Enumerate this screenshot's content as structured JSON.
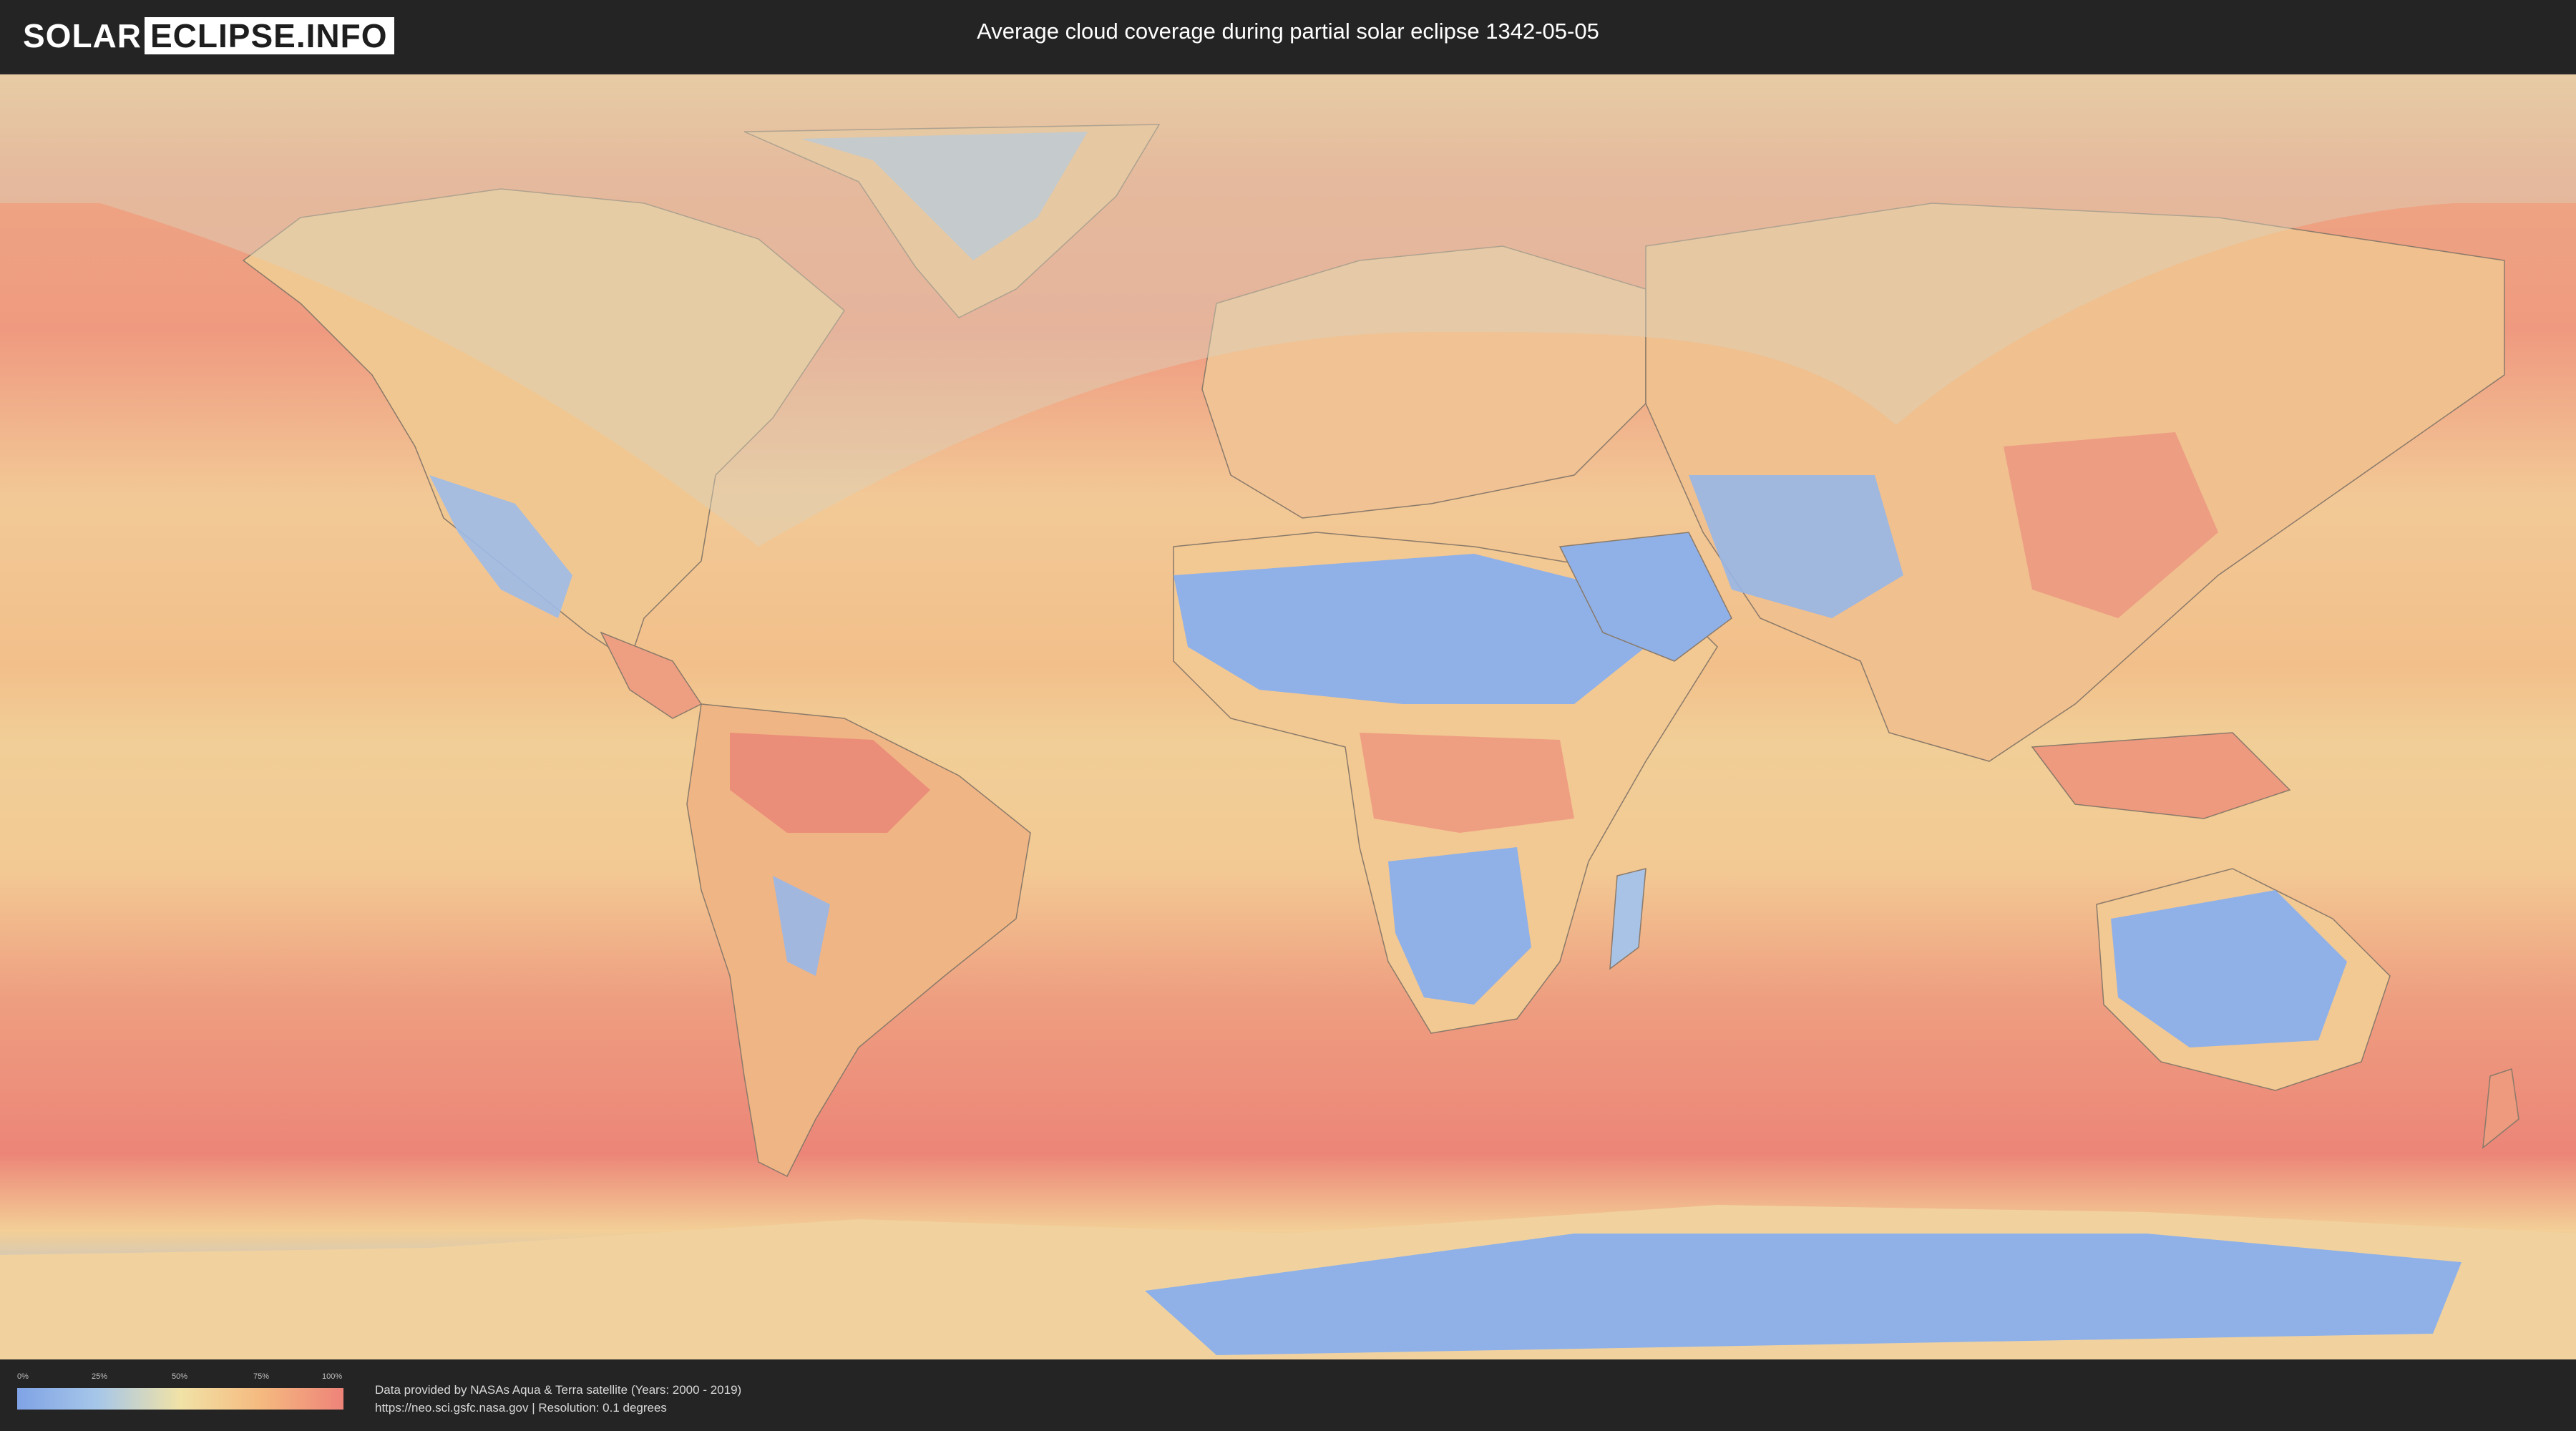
{
  "header": {
    "logo_part1": "SOLAR",
    "logo_part2": "ECLIPSE.INFO",
    "title": "Average cloud coverage during partial solar eclipse 1342-05-05"
  },
  "legend": {
    "labels": [
      "0%",
      "25%",
      "50%",
      "75%",
      "100%"
    ],
    "colors": [
      "#7fa3e6",
      "#a7c7e8",
      "#f1e2a6",
      "#f5b97f",
      "#ee8379"
    ]
  },
  "footer": {
    "credit_line1": "Data provided by NASAs Aqua & Terra satellite (Years: 2000 - 2019)",
    "credit_line2": "https://neo.sci.gsfc.nasa.gov | Resolution: 0.1 degrees"
  },
  "map": {
    "ocean_color": "#f0b78a",
    "cloudy_color": "#ee8379",
    "clear_color": "#8fb1e8",
    "shade_color": "#d9d2bd"
  }
}
